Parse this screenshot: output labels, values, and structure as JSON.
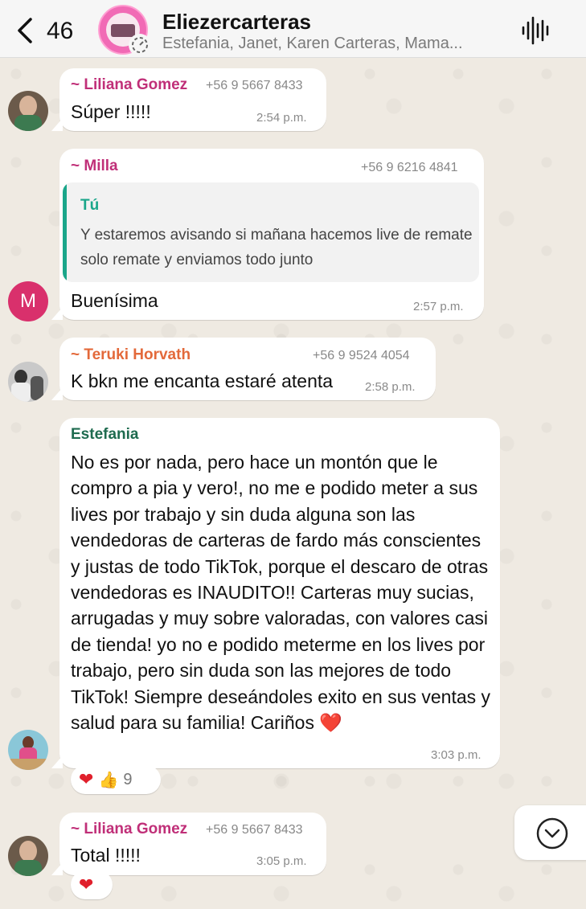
{
  "header": {
    "back_count": "46",
    "title": "Eliezercarteras",
    "subtitle": "Estefania, Janet, Karen Carteras, Mama..."
  },
  "messages": [
    {
      "sender": "~ Liliana Gomez",
      "sender_color": "#c02f78",
      "phone": "+56 9 5667 8433",
      "text": "Súper !!!!!",
      "time": "2:54 p.m."
    },
    {
      "sender": "~ Milla",
      "sender_color": "#c02f78",
      "phone": "+56 9 6216 4841",
      "quote": {
        "name": "Tú",
        "text": "Y estaremos avisando si mañana hacemos live de remate solo remate y enviamos todo junto"
      },
      "avatar_letter": "M",
      "text": "Buenísima",
      "time": "2:57 p.m."
    },
    {
      "sender": "~ Teruki Horvath",
      "sender_color": "#e3693a",
      "phone": "+56 9 9524 4054",
      "text": "K bkn me encanta estaré atenta",
      "time": "2:58 p.m."
    },
    {
      "sender": "Estefania",
      "sender_color": "#1e6b4f",
      "text": "No es por nada, pero hace un montón que le compro a pia y vero!, no me e podido meter a sus lives por trabajo y sin duda alguna son las vendedoras de carteras de fardo más conscientes y justas de todo TikTok, porque el descaro de otras vendedoras es INAUDITO!! Carteras muy sucias, arrugadas y muy sobre valoradas, con valores casi de tienda! yo no e podido meterme en los lives por trabajo, pero sin duda son las mejores de todo TikTok! Siempre deseándoles exito en sus ventas y salud para su familia! Cariños ❤️",
      "time": "3:03 p.m.",
      "reaction_count": "9"
    },
    {
      "sender": "~ Liliana Gomez",
      "sender_color": "#c02f78",
      "phone": "+56 9 5667 8433",
      "text": "Total !!!!!",
      "time": "3:05 p.m."
    }
  ],
  "icons": {
    "back": "chevron-left-icon",
    "voice": "audio-wave-icon",
    "scroll": "chevron-down-circle-icon",
    "heart": "❤",
    "thumb": "👍"
  }
}
